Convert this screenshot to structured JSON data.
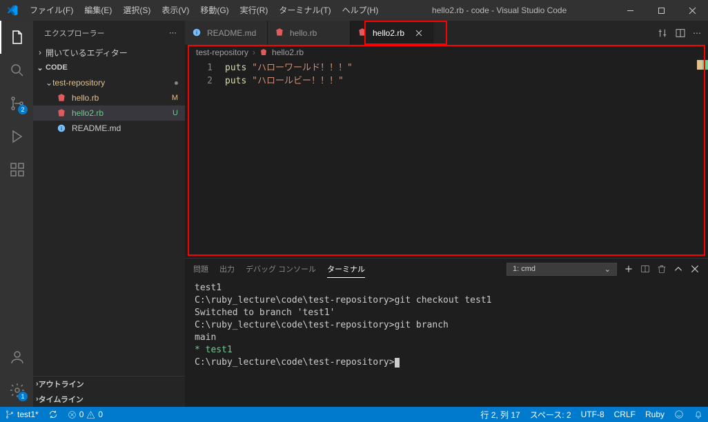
{
  "window": {
    "title": "hello2.rb - code - Visual Studio Code"
  },
  "menu": {
    "file": "ファイル(F)",
    "edit": "編集(E)",
    "selection": "選択(S)",
    "view": "表示(V)",
    "go": "移動(G)",
    "run": "実行(R)",
    "terminal": "ターミナル(T)",
    "help": "ヘルプ(H)"
  },
  "activity": {
    "scm_badge": "2",
    "settings_badge": "1"
  },
  "sidebar": {
    "title": "エクスプローラー",
    "open_editors": "開いているエディター",
    "workspace": "CODE",
    "repo": "test-repository",
    "files": {
      "hello": "hello.rb",
      "hello2": "hello2.rb",
      "readme": "README.md"
    },
    "status": {
      "hello": "M",
      "hello2": "U"
    },
    "outline": "アウトライン",
    "timeline": "タイムライン"
  },
  "tabs": {
    "readme": "README.md",
    "hello": "hello.rb",
    "hello2": "hello2.rb"
  },
  "breadcrumb": {
    "folder": "test-repository",
    "file": "hello2.rb"
  },
  "editor": {
    "l1_kw": "puts",
    "l1_str": "\"ハローワールド！！！\"",
    "l2_kw": "puts",
    "l2_str": "\"ハロールビー！！！\""
  },
  "panel": {
    "problems": "問題",
    "output": "出力",
    "debug": "デバッグ コンソール",
    "terminal": "ターミナル"
  },
  "terminal_select": {
    "label": "1: cmd"
  },
  "terminal": {
    "l1": "  test1",
    "l2": "",
    "l3": "C:\\ruby_lecture\\code\\test-repository>git checkout test1",
    "l4": "Switched to branch 'test1'",
    "l5": "",
    "l6": "C:\\ruby_lecture\\code\\test-repository>git branch",
    "l7": "  main",
    "l8": "* test1",
    "l9": "",
    "l10": "C:\\ruby_lecture\\code\\test-repository>"
  },
  "status": {
    "branch": "test1*",
    "sync": "",
    "errors": "0",
    "warnings": "0",
    "ln_col": "行 2, 列 17",
    "spaces": "スペース: 2",
    "encoding": "UTF-8",
    "eol": "CRLF",
    "lang": "Ruby"
  }
}
